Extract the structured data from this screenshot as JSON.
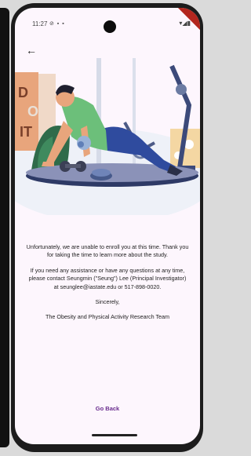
{
  "status_bar": {
    "time": "11:27",
    "left_icons": "⊘ ▪ ▪",
    "right_icons": "▾◢▮"
  },
  "nav": {
    "back_icon": "arrow-back-icon"
  },
  "message": {
    "p1": "Unfortunately, we are unable to enroll you at this time. Thank you for taking the time to learn more about the study.",
    "p2": "If you need any assistance or have any questions at any time, please contact Seungmin (\"Seung\") Lee (Principal Investigator) at seunglee@iastate.edu or 517-898-0020.",
    "p3": "Sincerely,",
    "p4": "The Obesity and Physical Activity Research Team"
  },
  "actions": {
    "go_back_label": "Go Back"
  },
  "colors": {
    "accent": "#6a2d8e",
    "background": "#fdf6fd"
  }
}
